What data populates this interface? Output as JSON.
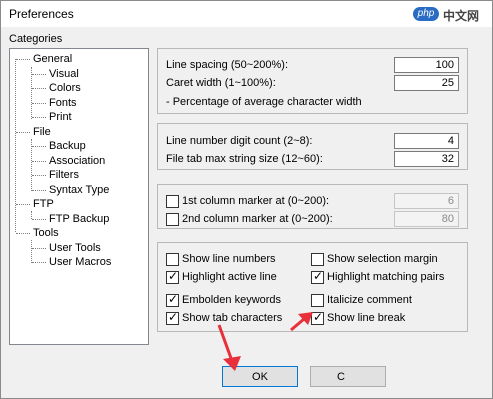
{
  "window": {
    "title": "Preferences"
  },
  "watermark": {
    "logo": "php",
    "text": "中文网"
  },
  "categories": {
    "label": "Categories",
    "tree": [
      {
        "label": "General",
        "children": [
          "Visual",
          "Colors",
          "Fonts",
          "Print"
        ]
      },
      {
        "label": "File",
        "children": [
          "Backup",
          "Association",
          "Filters",
          "Syntax Type"
        ]
      },
      {
        "label": "FTP",
        "children": [
          "FTP Backup"
        ]
      },
      {
        "label": "Tools",
        "children": [
          "User Tools",
          "User Macros"
        ]
      }
    ]
  },
  "spacing": {
    "line_spacing_label": "Line spacing (50~200%):",
    "line_spacing_value": "100",
    "caret_width_label": "Caret width (1~100%):",
    "caret_width_value": "25",
    "note": "- Percentage of average character width"
  },
  "linenum": {
    "digit_count_label": "Line number digit count (2~8):",
    "digit_count_value": "4",
    "tab_max_label": "File tab max string size (12~60):",
    "tab_max_value": "32"
  },
  "markers": {
    "first_label": "1st column marker at (0~200):",
    "first_value": "6",
    "second_label": "2nd column marker at (0~200):",
    "second_value": "80"
  },
  "options": {
    "show_line_numbers": {
      "label": "Show line numbers",
      "checked": false
    },
    "show_selection_margin": {
      "label": "Show selection margin",
      "checked": false
    },
    "highlight_active_line": {
      "label": "Highlight active line",
      "checked": true
    },
    "highlight_matching_pairs": {
      "label": "Highlight matching pairs",
      "checked": true
    },
    "embolden_keywords": {
      "label": "Embolden keywords",
      "checked": true
    },
    "italicize_comment": {
      "label": "Italicize comment",
      "checked": false
    },
    "show_tab_characters": {
      "label": "Show tab characters",
      "checked": true
    },
    "show_line_break": {
      "label": "Show line break",
      "checked": true
    }
  },
  "buttons": {
    "ok": "OK",
    "cancel": "C"
  },
  "colors": {
    "arrow": "#e8303a",
    "ok_border": "#0078d7"
  }
}
